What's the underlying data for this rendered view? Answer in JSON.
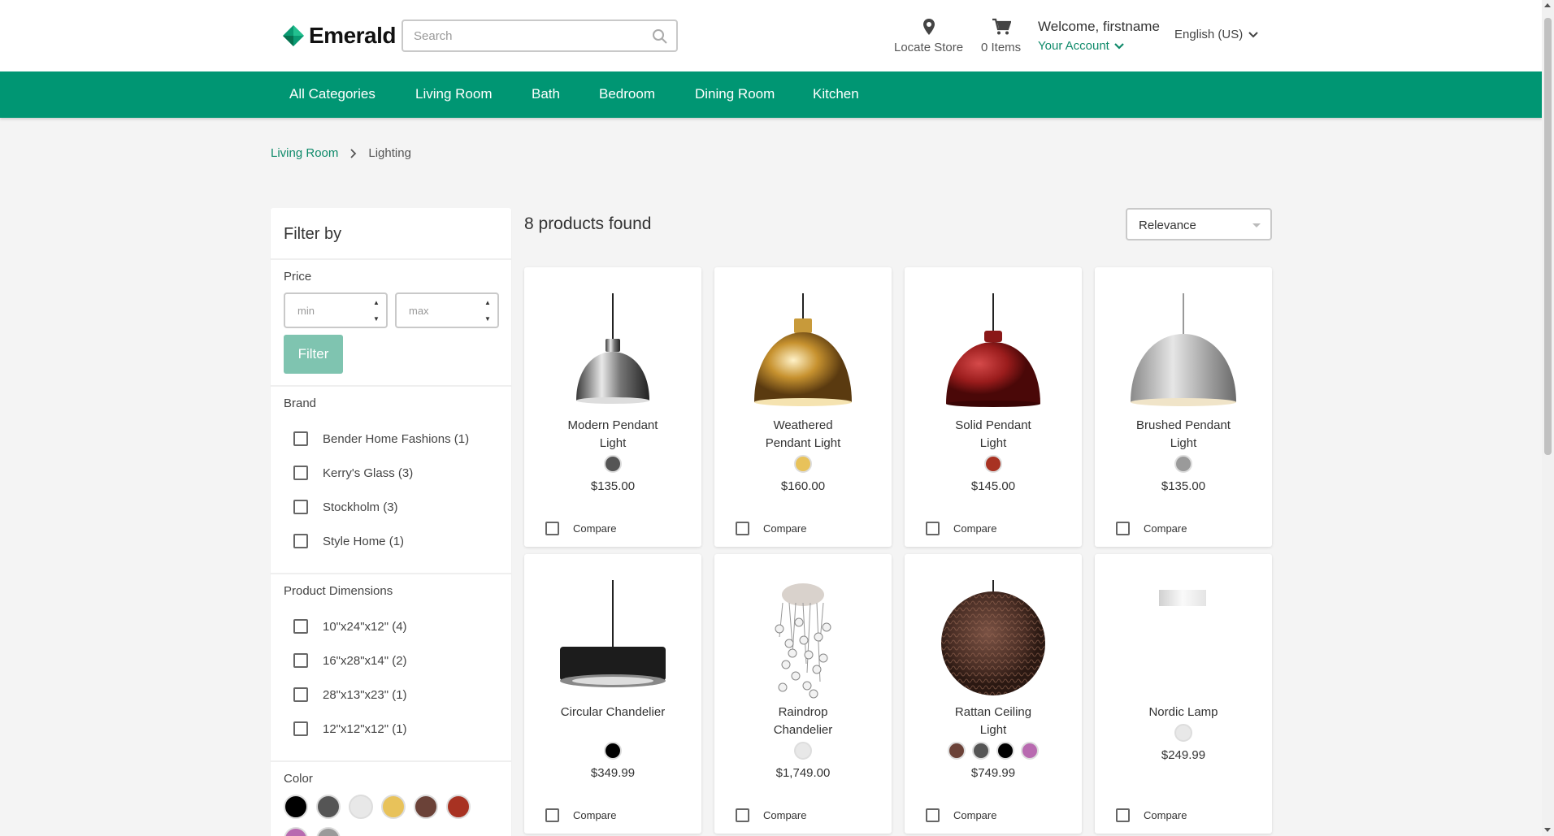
{
  "header": {
    "brand": "Emerald",
    "search_placeholder": "Search",
    "locate_store": "Locate Store",
    "cart_items": "0 Items",
    "welcome": "Welcome, firstname",
    "your_account": "Your Account",
    "language": "English (US)"
  },
  "nav": {
    "items": [
      "All Categories",
      "Living Room",
      "Bath",
      "Bedroom",
      "Dining Room",
      "Kitchen"
    ]
  },
  "breadcrumb": {
    "parent": "Living Room",
    "current": "Lighting"
  },
  "filters": {
    "title": "Filter by",
    "price_label": "Price",
    "min_placeholder": "min",
    "max_placeholder": "max",
    "filter_button": "Filter",
    "brand_label": "Brand",
    "brands": [
      "Bender Home Fashions (1)",
      "Kerry's Glass (3)",
      "Stockholm (3)",
      "Style Home (1)"
    ],
    "dimensions_label": "Product Dimensions",
    "dimensions": [
      "10\"x24\"x12\" (4)",
      "16\"x28\"x14\" (2)",
      "28\"x13\"x23\" (1)",
      "12\"x12\"x12\" (1)"
    ],
    "color_label": "Color",
    "colors": [
      "#000000",
      "#555555",
      "#e8e8e8",
      "#e8c25a",
      "#6b4238",
      "#a83222",
      "#b86ab0",
      "#9a9a9a"
    ]
  },
  "results": {
    "count_text": "8 products found",
    "sort_value": "Relevance",
    "compare_label": "Compare",
    "products": [
      {
        "name": "Modern Pendant Light",
        "price": "$135.00",
        "colors": [
          "#555555"
        ],
        "image": "pendant-chrome"
      },
      {
        "name": "Weathered Pendant Light",
        "price": "$160.00",
        "colors": [
          "#e8c25a"
        ],
        "image": "pendant-gold"
      },
      {
        "name": "Solid Pendant Light",
        "price": "$145.00",
        "colors": [
          "#a83222"
        ],
        "image": "pendant-red"
      },
      {
        "name": "Brushed Pendant Light",
        "price": "$135.00",
        "colors": [
          "#9a9a9a"
        ],
        "image": "pendant-brushed"
      },
      {
        "name": "Circular Chandelier",
        "price": "$349.99",
        "colors": [
          "#000000"
        ],
        "image": "chandelier-drum"
      },
      {
        "name": "Raindrop Chandelier",
        "price": "$1,749.00",
        "colors": [
          "#e8e8e8"
        ],
        "image": "chandelier-crystal"
      },
      {
        "name": "Rattan Ceiling Light",
        "price": "$749.99",
        "colors": [
          "#6b4238",
          "#555555",
          "#000000",
          "#b86ab0"
        ],
        "image": "rattan-ball"
      },
      {
        "name": "Nordic Lamp",
        "price": "$249.99",
        "colors": [
          "#e8e8e8"
        ],
        "image": "nordic-lamp"
      }
    ]
  }
}
